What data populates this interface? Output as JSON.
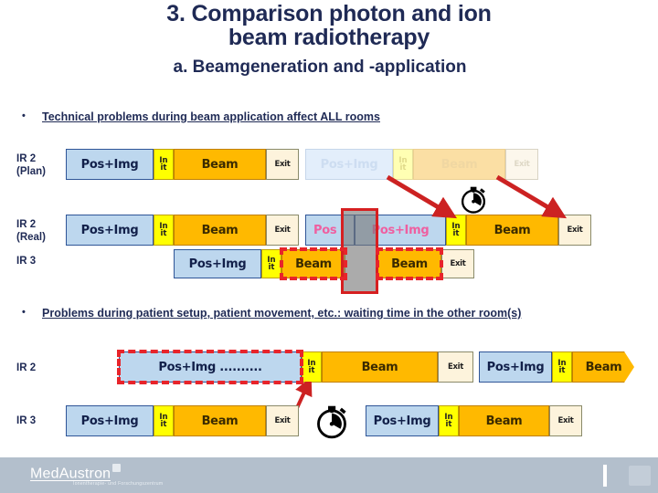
{
  "title": {
    "line1": "3. Comparison photon  and ion",
    "line2": "beam radiotherapy",
    "subtitle": "a. Beamgeneration and -application"
  },
  "bullets": {
    "dot": "•",
    "first": "Technical problems during beam application affect ALL rooms",
    "second": "Problems during patient setup, patient movement, etc.: waiting time in the other room(s)"
  },
  "labels": {
    "ir2_plan_l1": "IR 2",
    "ir2_plan_l2": "(Plan)",
    "ir2_real_l1": "IR 2",
    "ir2_real_l2": "(Real)",
    "ir3_top": "IR 3",
    "ir2_bottom": "IR 2",
    "ir3_bottom": "IR 3"
  },
  "blocks": {
    "pos": "Pos+Img",
    "pos_dots": "Pos+Img ..........",
    "pos_partial": "Pos",
    "init_l1": "In",
    "init_l2": "it",
    "beam": "Beam",
    "exit": "Exit"
  },
  "icons": {
    "stopwatch": "stopwatch-icon",
    "arrow": "red-arrow-icon",
    "bullet": "bullet-dot-icon"
  },
  "footer": {
    "brand": "MedAustron",
    "tagline": "Ionentherapie- und Forschungszentrum"
  },
  "colors": {
    "title": "#1f2a55",
    "pos_fill": "#bdd7ee",
    "init_fill": "#ffff00",
    "beam_fill": "#ffb900",
    "exit_fill": "#fdf3dc",
    "highlight_red": "#e8242a",
    "arrow_red": "#cc2222",
    "footer_bg": "#b3bfcc",
    "gray_overlay": "#787878"
  }
}
